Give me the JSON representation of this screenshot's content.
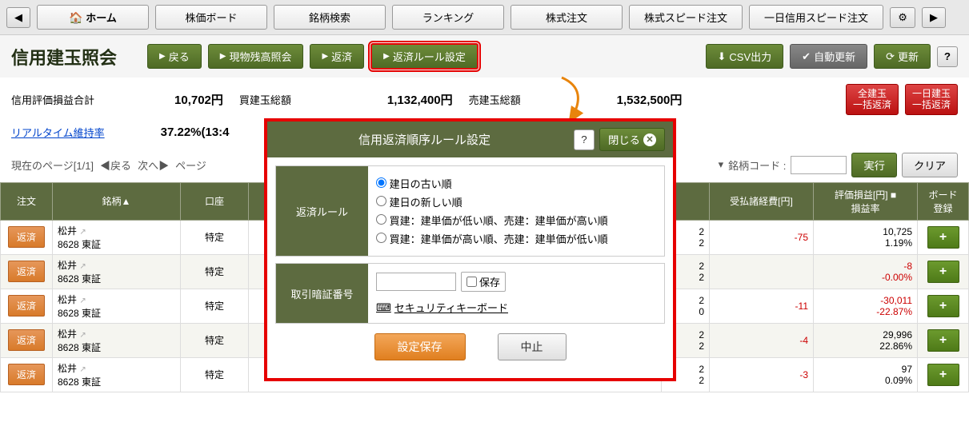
{
  "topnav": {
    "tabs": [
      "ホーム",
      "株価ボード",
      "銘柄検索",
      "ランキング",
      "株式注文",
      "株式スピード注文",
      "一日信用スピード注文"
    ]
  },
  "page": {
    "title": "信用建玉照会"
  },
  "toolbar": {
    "back": "戻る",
    "genbutsu": "現物残高照会",
    "hensai": "返済",
    "rule": "返済ルール設定",
    "csv": "CSV出力",
    "auto": "自動更新",
    "refresh": "更新"
  },
  "summary": {
    "pl_label": "信用評価損益合計",
    "pl_value": "10,702円",
    "buy_label": "買建玉総額",
    "buy_value": "1,132,400円",
    "sell_label": "売建玉総額",
    "sell_value": "1,532,500円",
    "rt_label": "リアルタイム維持率",
    "rt_value": "37.22%(13:4"
  },
  "badges": {
    "all": "全建玉\n一括返済",
    "day": "一日建玉\n一括返済"
  },
  "pager": {
    "info": "現在のページ[1/1]",
    "back": "◀戻る",
    "next": "次へ▶",
    "pagesize": "ページ",
    "code_label": "銘柄コード :",
    "exec": "実行",
    "clear": "クリア"
  },
  "headers": {
    "order": "注文",
    "symbol": "銘柄▲",
    "account": "口座",
    "cost": "受払諸経費[円]",
    "pl": "評価損益[円] ■\n損益率",
    "board": "ボード\n登録"
  },
  "rows": [
    {
      "name": "松井",
      "code": "8628 東証",
      "acct": "特定",
      "c1": "2",
      "c2": "2",
      "cost": "-75",
      "pl": "10,725",
      "rate": "1.19%",
      "neg": false,
      "costneg": true
    },
    {
      "name": "松井",
      "code": "8628 東証",
      "acct": "特定",
      "c1": "2",
      "c2": "2",
      "cost": "",
      "pl": "-8",
      "rate": "-0.00%",
      "neg": true,
      "costneg": false
    },
    {
      "name": "松井",
      "code": "8628 東証",
      "acct": "特定",
      "c1": "2",
      "c2": "0",
      "cost": "-11",
      "pl": "-30,011",
      "rate": "-22.87%",
      "neg": true,
      "costneg": true
    },
    {
      "name": "松井",
      "code": "8628 東証",
      "acct": "特定",
      "c1": "2",
      "c2": "2",
      "cost": "-4",
      "pl": "29,996",
      "rate": "22.86%",
      "neg": false,
      "costneg": true
    },
    {
      "name": "松井",
      "code": "8628 東証",
      "acct": "特定",
      "c1": "2",
      "c2": "2",
      "cost": "-3",
      "pl": "97",
      "rate": "0.09%",
      "neg": false,
      "costneg": true
    }
  ],
  "row_btn": "返済",
  "dialog": {
    "title": "信用返済順序ルール設定",
    "close": "閉じる",
    "rule_label": "返済ルール",
    "opts": [
      "建日の古い順",
      "建日の新しい順",
      "買建：建単価が低い順、売建：建単価が高い順",
      "買建：建単価が高い順、売建：建単価が低い順"
    ],
    "pin_label": "取引暗証番号",
    "save_check": "保存",
    "sec_kb": "セキュリティキーボード",
    "save": "設定保存",
    "cancel": "中止"
  }
}
